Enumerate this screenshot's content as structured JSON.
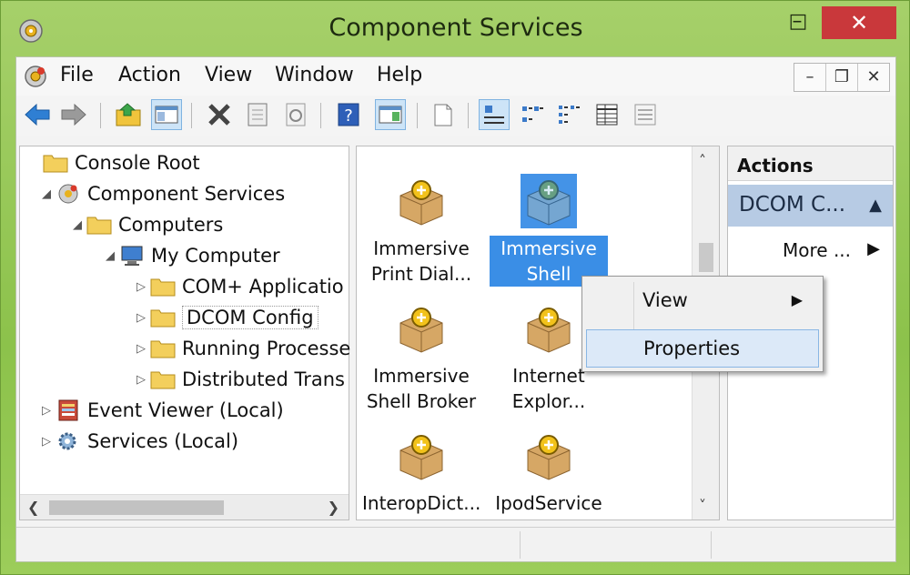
{
  "window": {
    "title": "Component Services",
    "controls": {
      "minimize": "–",
      "maximize": "□",
      "close": "✕"
    }
  },
  "menubar": {
    "items": [
      "File",
      "Action",
      "View",
      "Window",
      "Help"
    ],
    "mdi_controls": {
      "minimize": "–",
      "restore": "❐",
      "close": "✕"
    }
  },
  "toolbar": {
    "buttons": [
      "back-icon",
      "forward-icon",
      "up-folder-icon",
      "show-hide-tree-icon",
      "delete-icon",
      "properties-icon",
      "refresh-icon",
      "help-icon",
      "show-action-pane-icon",
      "new-icon",
      "large-icons-view-icon",
      "small-icons-view-icon",
      "list-view-icon",
      "detail-view-icon",
      "status-view-icon"
    ]
  },
  "tree": {
    "items": [
      {
        "label": "Console Root",
        "arrow": "",
        "icon": "folder-icon"
      },
      {
        "label": "Component Services",
        "arrow": "◢",
        "icon": "component-services-icon"
      },
      {
        "label": "Computers",
        "arrow": "◢",
        "icon": "folder-icon"
      },
      {
        "label": "My Computer",
        "arrow": "◢",
        "icon": "computer-icon"
      },
      {
        "label": "COM+ Applicatio",
        "arrow": "▷",
        "icon": "folder-icon"
      },
      {
        "label": "DCOM Config",
        "arrow": "▷",
        "icon": "folder-icon"
      },
      {
        "label": "Running Processe",
        "arrow": "▷",
        "icon": "folder-icon"
      },
      {
        "label": "Distributed Trans",
        "arrow": "▷",
        "icon": "folder-icon"
      },
      {
        "label": "Event Viewer (Local)",
        "arrow": "▷",
        "icon": "event-viewer-icon"
      },
      {
        "label": "Services (Local)",
        "arrow": "▷",
        "icon": "services-gear-icon"
      }
    ],
    "selected_label": "DCOM Config"
  },
  "components": {
    "items": [
      {
        "line1": "Immersive",
        "line2": "Print Dial..."
      },
      {
        "line1": "Immersive",
        "line2": "Shell"
      },
      {
        "line1": "Immersive",
        "line2": "Shell Broker"
      },
      {
        "line1": "Internet",
        "line2": "Explor..."
      },
      {
        "line1": "InteropDict...",
        "line2": ""
      },
      {
        "line1": "IpodService",
        "line2": ""
      }
    ],
    "selected_index": 1
  },
  "actions": {
    "header": "Actions",
    "section": "DCOM C...",
    "section_arrow": "▲",
    "more": "More ...",
    "more_arrow": "▶"
  },
  "context_menu": {
    "items": [
      {
        "label": "View",
        "submenu": "▶"
      },
      {
        "label": "Properties",
        "submenu": ""
      }
    ],
    "highlighted": "Properties"
  },
  "colors": {
    "accent_selection": "#3a8ee6",
    "close_button": "#c9383b",
    "action_section_bg": "#b7cbe4",
    "desktop_green": "#8cc14a"
  }
}
